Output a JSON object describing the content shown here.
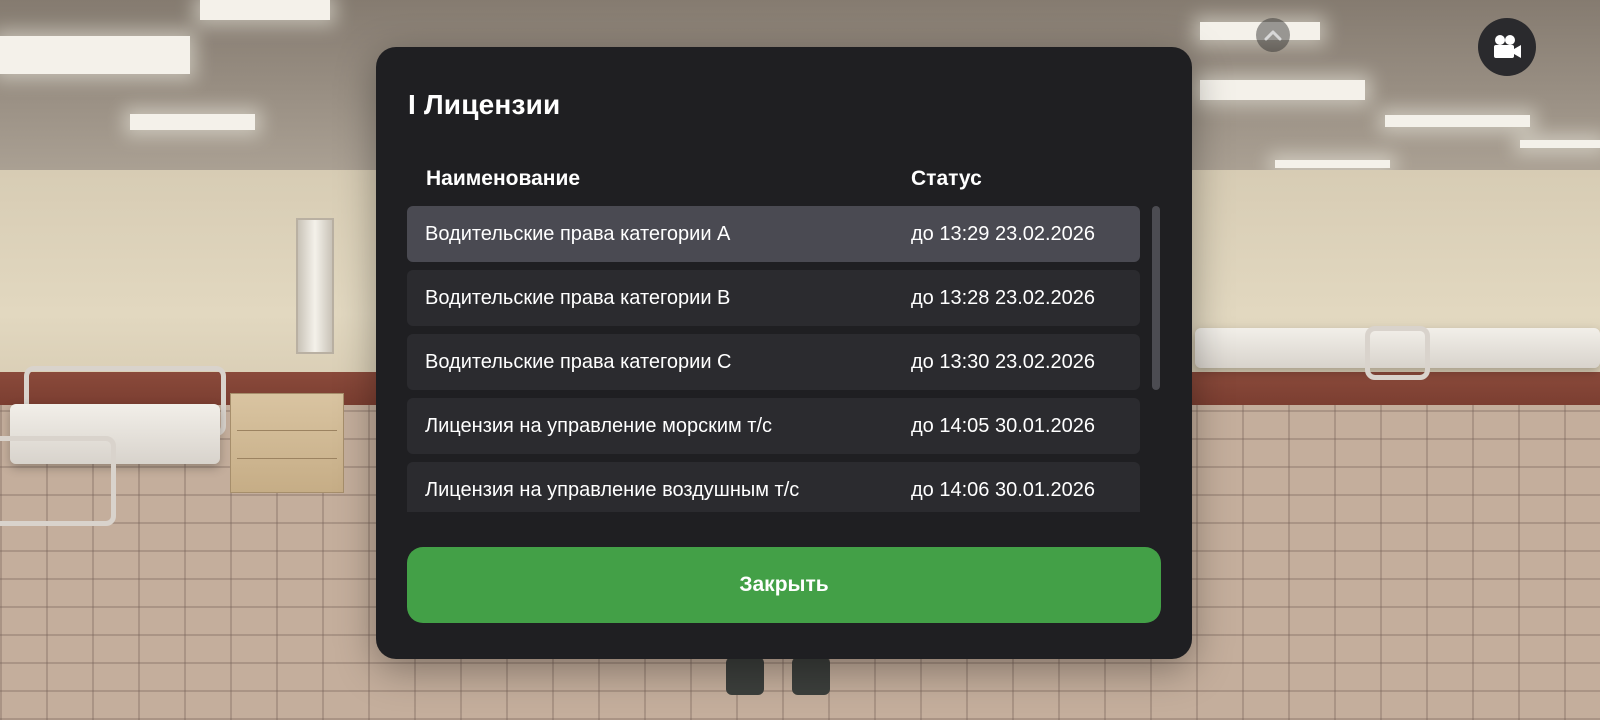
{
  "modal": {
    "title": "I Лицензии",
    "headers": {
      "name": "Наименование",
      "status": "Статус"
    },
    "rows": [
      {
        "name": "Водительские права категории A",
        "status": "до 13:29 23.02.2026"
      },
      {
        "name": "Водительские права категории B",
        "status": "до 13:28 23.02.2026"
      },
      {
        "name": "Водительские права категории C",
        "status": "до 13:30 23.02.2026"
      },
      {
        "name": "Лицензия на управление морским т/с",
        "status": "до 14:05 30.01.2026"
      },
      {
        "name": "Лицензия на управление воздушным т/с",
        "status": "до 14:06 30.01.2026"
      }
    ],
    "close_label": "Закрыть"
  },
  "hud": {
    "chevron_icon": "chevron-up-icon",
    "camera_icon": "video-camera-icon"
  },
  "colors": {
    "modal_bg": "#1f1f22",
    "row_bg": "#2b2b2f",
    "row_active_bg": "#4a4a52",
    "accent_green": "#43a047"
  }
}
